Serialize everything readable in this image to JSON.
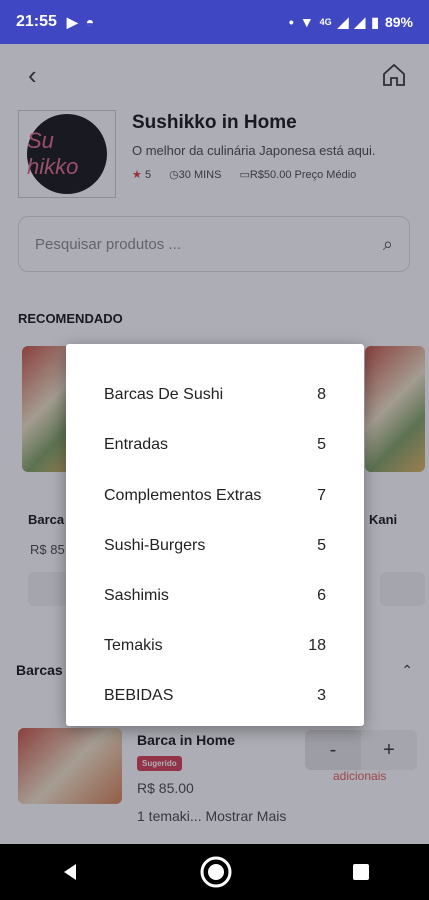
{
  "status": {
    "time": "21:55",
    "network": "4G",
    "battery": "89%",
    "left_icons": [
      "youtube-icon",
      "incognito-icon"
    ],
    "right_icons": [
      "dot-icon",
      "wifi-icon",
      "signal-icon",
      "signal-icon",
      "battery-icon"
    ]
  },
  "restaurant": {
    "logo_text": "Su hikko",
    "name": "Sushikko in Home",
    "description": "O melhor da culinária Japonesa está aqui.",
    "rating": "5",
    "time": "30 MINS",
    "price": "R$50.00 Preço Médio"
  },
  "search": {
    "placeholder": "Pesquisar produtos ..."
  },
  "recommended": {
    "title": "RECOMENDADO",
    "cards": [
      {
        "title": "Barca",
        "price": "R$ 85"
      },
      {
        "title": "Kani",
        "price": ""
      }
    ]
  },
  "category_bar": {
    "label": "Barcas"
  },
  "item": {
    "title": "Barca in Home",
    "badge": "Sugerido",
    "price": "R$ 85.00",
    "description": "1 temaki... Mostrar Mais",
    "minus": "-",
    "plus": "+",
    "adicionais": "adicionais"
  },
  "dialog": {
    "categories": [
      {
        "name": "Barcas De Sushi",
        "count": "8"
      },
      {
        "name": "Entradas",
        "count": "5"
      },
      {
        "name": "Complementos Extras",
        "count": "7"
      },
      {
        "name": "Sushi-Burgers",
        "count": "5"
      },
      {
        "name": "Sashimis",
        "count": "6"
      },
      {
        "name": "Temakis",
        "count": "18"
      },
      {
        "name": "BEBIDAS",
        "count": "3"
      }
    ]
  },
  "colors": {
    "statusbar": "#3f48c2",
    "accent": "#d33a4e"
  }
}
